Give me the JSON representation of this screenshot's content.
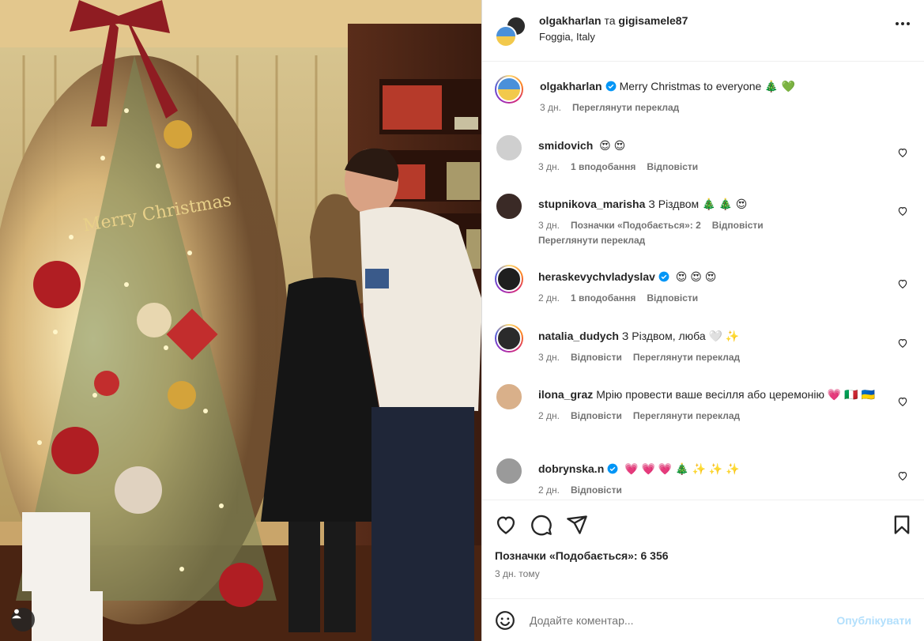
{
  "header": {
    "user1": "olgakharlan",
    "connector": "та",
    "user2": "gigisamele87",
    "location": "Foggia, Italy"
  },
  "photo": {
    "sign_text": "Merry Christmas"
  },
  "comments": [
    {
      "user": "olgakharlan",
      "verified": true,
      "text": "Merry Christmas to everyone",
      "emojis": [
        "🎄",
        "💚"
      ],
      "time": "3 дн.",
      "likes": "",
      "reply": "",
      "translate": "Переглянути переклад",
      "owner": true
    },
    {
      "user": "smidovich",
      "verified": false,
      "text": "",
      "emojis": [
        "😍",
        "😍"
      ],
      "time": "3 дн.",
      "likes": "1 вподобання",
      "reply": "Відповісти",
      "translate": ""
    },
    {
      "user": "stupnikova_marisha",
      "verified": false,
      "text": "З Різдвом",
      "emojis": [
        "🎄",
        "🎄",
        "😍"
      ],
      "time": "3 дн.",
      "likes": "Позначки «Подобається»: 2",
      "reply": "Відповісти",
      "translate": "Переглянути переклад"
    },
    {
      "user": "heraskevychvladyslav",
      "verified": true,
      "text": "",
      "emojis": [
        "😍",
        "😍",
        "😍"
      ],
      "time": "2 дн.",
      "likes": "1 вподобання",
      "reply": "Відповісти",
      "translate": ""
    },
    {
      "user": "natalia_dudych",
      "verified": false,
      "text": "З Різдвом, люба",
      "emojis": [
        "🤍",
        "✨"
      ],
      "time": "3 дн.",
      "likes": "",
      "reply": "Відповісти",
      "translate": "Переглянути переклад"
    },
    {
      "user": "ilona_graz",
      "verified": false,
      "text": "Мрію провести ваше весілля або церемонію",
      "emojis": [
        "💗",
        "🇮🇹",
        "🇺🇦"
      ],
      "time": "2 дн.",
      "likes": "",
      "reply": "Відповісти",
      "translate": "Переглянути переклад"
    },
    {
      "user": "dobrynska.n",
      "verified": true,
      "text": "",
      "emojis": [
        "💗",
        "💗",
        "💗",
        "🎄",
        "✨",
        "✨",
        "✨"
      ],
      "time": "2 дн.",
      "likes": "",
      "reply": "Відповісти",
      "translate": ""
    }
  ],
  "actions": {
    "like_icon": "heart-icon",
    "comment_icon": "comment-icon",
    "share_icon": "share-icon",
    "save_icon": "bookmark-icon",
    "likes_text": "Позначки «Подобається»: 6 356",
    "posted_ago": "3 дн. тому"
  },
  "add_comment": {
    "placeholder": "Додайте коментар...",
    "post_label": "Опублікувати"
  },
  "colors": {
    "verified": "#0095f6",
    "post_disabled": "#b2dffc",
    "muted": "#737373"
  }
}
